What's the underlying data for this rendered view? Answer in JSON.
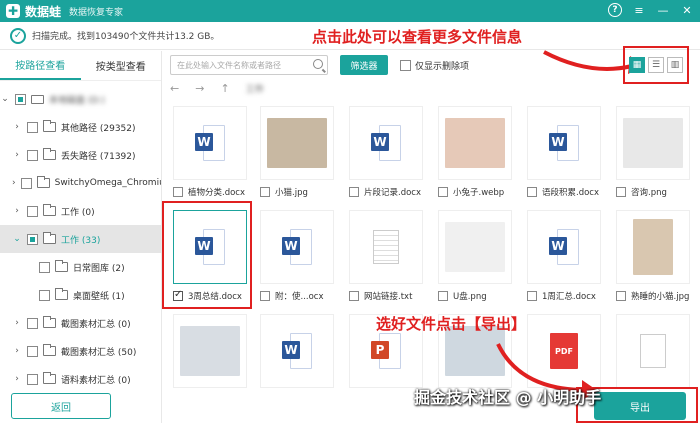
{
  "app": {
    "name": "数据蛙",
    "subtitle": "数据恢复专家",
    "help": "?"
  },
  "status": {
    "text": "扫描完成。找到103490个文件共计13.2 GB。"
  },
  "annotations": {
    "top": "点击此处可以查看更多文件信息",
    "bottom": "选好文件点击【导出】",
    "watermark": "掘金技术社区 @ 小明助手"
  },
  "left_tabs": {
    "by_path": "按路径查看",
    "by_type": "按类型查看"
  },
  "tree": [
    {
      "label": "其他路径 (29352)"
    },
    {
      "label": "丢失路径 (71392)"
    },
    {
      "label": "SwitchyOmega_Chromium"
    },
    {
      "label": "工作 (0)"
    },
    {
      "label": "工作 (33)"
    },
    {
      "label": "日常图库 (2)"
    },
    {
      "label": "桌面壁纸 (1)"
    },
    {
      "label": "截图素材汇总 (0)"
    },
    {
      "label": "截图素材汇总 (50)"
    },
    {
      "label": "语料素材汇总 (0)"
    }
  ],
  "tree_root": "本地磁盘 (D:)",
  "back_label": "返回",
  "search": {
    "placeholder": "在此处输入文件名称或者路径",
    "filter_label": "筛选器",
    "only_deleted_label": "仅显示删除项"
  },
  "view_modes": [
    "thumbnail",
    "list",
    "detail"
  ],
  "nav": {
    "back_icon": "←",
    "forward_icon": "→",
    "up_icon": "↑",
    "path": "工作"
  },
  "files": [
    {
      "name": "植物分类.docx",
      "icon": "word"
    },
    {
      "name": "小猫.jpg",
      "icon": "photo-cat"
    },
    {
      "name": "片段记录.docx",
      "icon": "word"
    },
    {
      "name": "小兔子.webp",
      "icon": "photo-bunny"
    },
    {
      "name": "语段积累.docx",
      "icon": "word"
    },
    {
      "name": "咨询.png",
      "icon": "photo-room"
    },
    {
      "name": "3周总结.docx",
      "icon": "word"
    },
    {
      "name": "附：使...ocx",
      "icon": "word"
    },
    {
      "name": "网站链接.txt",
      "icon": "txt"
    },
    {
      "name": "U盘.png",
      "icon": "photo-usb"
    },
    {
      "name": "1周汇总.docx",
      "icon": "word"
    },
    {
      "name": "熟睡的小猫.jpg",
      "icon": "photo-cat2"
    },
    {
      "name": "",
      "icon": "photo-laptop"
    },
    {
      "name": "",
      "icon": "word"
    },
    {
      "name": "",
      "icon": "ppt"
    },
    {
      "name": "",
      "icon": "photo-desk"
    },
    {
      "name": "",
      "icon": "pdf"
    },
    {
      "name": "",
      "icon": "blank"
    }
  ],
  "file_badges": {
    "word": "W",
    "ppt": "P",
    "pdf": "PDF"
  },
  "export_label": "导出",
  "colors": {
    "accent": "#1ba39c",
    "annotation": "#e02020"
  }
}
